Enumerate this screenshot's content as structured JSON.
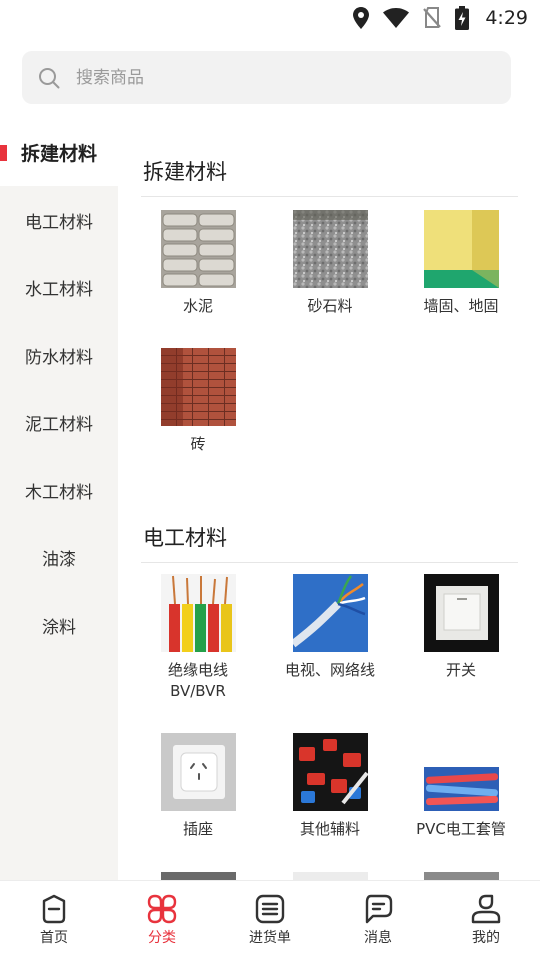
{
  "status_bar": {
    "time": "4:29",
    "icons": [
      "location-icon",
      "wifi-icon",
      "no-sim-icon",
      "battery-charging-icon"
    ]
  },
  "search": {
    "placeholder": "搜索商品",
    "icon": "search-icon"
  },
  "sidebar": {
    "items": [
      {
        "label": "拆建材料",
        "active": true
      },
      {
        "label": "电工材料",
        "active": false
      },
      {
        "label": "水工材料",
        "active": false
      },
      {
        "label": "防水材料",
        "active": false
      },
      {
        "label": "泥工材料",
        "active": false
      },
      {
        "label": "木工材料",
        "active": false
      },
      {
        "label": "油漆",
        "active": false
      },
      {
        "label": "涂料",
        "active": false
      }
    ]
  },
  "sections": [
    {
      "title": "拆建材料",
      "items": [
        {
          "label": "水泥",
          "image": "cement-bags-photo"
        },
        {
          "label": "砂石料",
          "image": "gravel-photo"
        },
        {
          "label": "墙固、地固",
          "image": "primed-room-photo"
        },
        {
          "label": "砖",
          "image": "brick-wall-photo"
        }
      ]
    },
    {
      "title": "电工材料",
      "items": [
        {
          "label": "绝缘电线",
          "label2": "BV/BVR",
          "image": "insulated-wires-photo"
        },
        {
          "label": "电视、网络线",
          "image": "network-cable-photo"
        },
        {
          "label": "开关",
          "image": "wall-switch-photo"
        },
        {
          "label": "插座",
          "image": "wall-socket-photo"
        },
        {
          "label": "其他辅料",
          "image": "electrical-fittings-photo"
        },
        {
          "label": "PVC电工套管",
          "image": "pvc-conduit-photo"
        }
      ]
    }
  ],
  "bottom_nav": {
    "items": [
      {
        "label": "首页",
        "icon": "home-icon",
        "active": false
      },
      {
        "label": "分类",
        "icon": "category-icon",
        "active": true
      },
      {
        "label": "进货单",
        "icon": "order-list-icon",
        "active": false
      },
      {
        "label": "消息",
        "icon": "message-icon",
        "active": false
      },
      {
        "label": "我的",
        "icon": "profile-icon",
        "active": false
      }
    ]
  },
  "colors": {
    "accent": "#e8333d",
    "sidebar_bg": "#f5f4f2",
    "search_bg": "#f2f2f2"
  }
}
